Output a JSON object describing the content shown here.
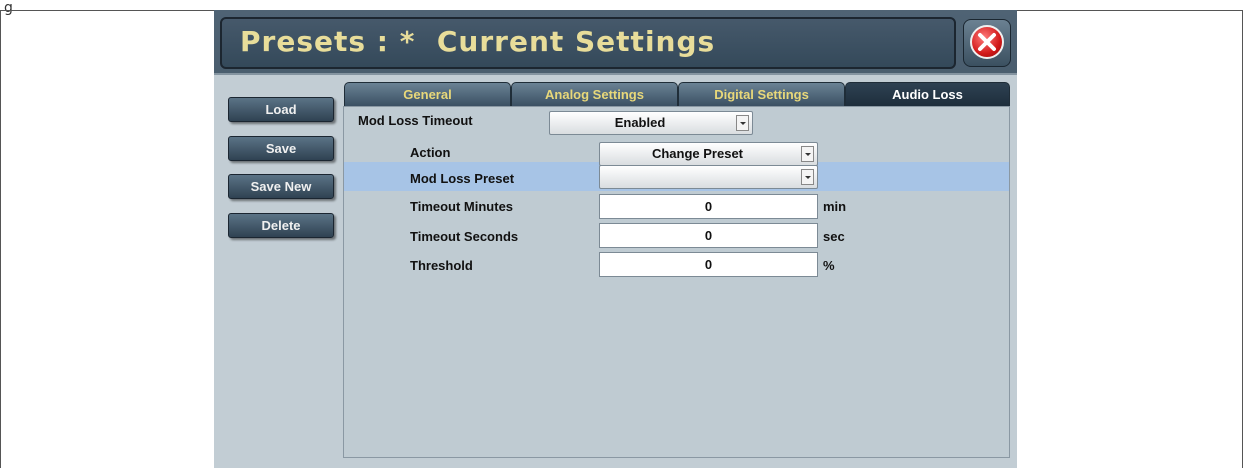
{
  "page": {
    "marker": "g"
  },
  "header": {
    "title": "Presets : *  Current Settings"
  },
  "sidebar": {
    "buttons": [
      {
        "label": "Load"
      },
      {
        "label": "Save"
      },
      {
        "label": "Save New"
      },
      {
        "label": "Delete"
      }
    ]
  },
  "tabs": [
    {
      "label": "General",
      "active": false
    },
    {
      "label": "Analog Settings",
      "active": false
    },
    {
      "label": "Digital Settings",
      "active": false
    },
    {
      "label": "Audio Loss",
      "active": true
    }
  ],
  "form": {
    "mod_loss_timeout": {
      "label": "Mod Loss Timeout",
      "value": "Enabled"
    },
    "action": {
      "label": "Action",
      "value": "Change Preset"
    },
    "mod_loss_preset": {
      "label": "Mod Loss Preset",
      "value": ""
    },
    "timeout_minutes": {
      "label": "Timeout Minutes",
      "value": "0",
      "unit": "min"
    },
    "timeout_seconds": {
      "label": "Timeout Seconds",
      "value": "0",
      "unit": "sec"
    },
    "threshold": {
      "label": "Threshold",
      "value": "0",
      "unit": "%"
    }
  },
  "colors": {
    "title_text": "#e8dd9a",
    "tab_text": "#e8d87a",
    "panel_bg": "#c2cdd4",
    "row_highlight": "#a7c4e6",
    "close_button": "#d21a1a"
  },
  "icons": {
    "close": "close-x-icon",
    "dropdown": "chevron-down-icon"
  }
}
